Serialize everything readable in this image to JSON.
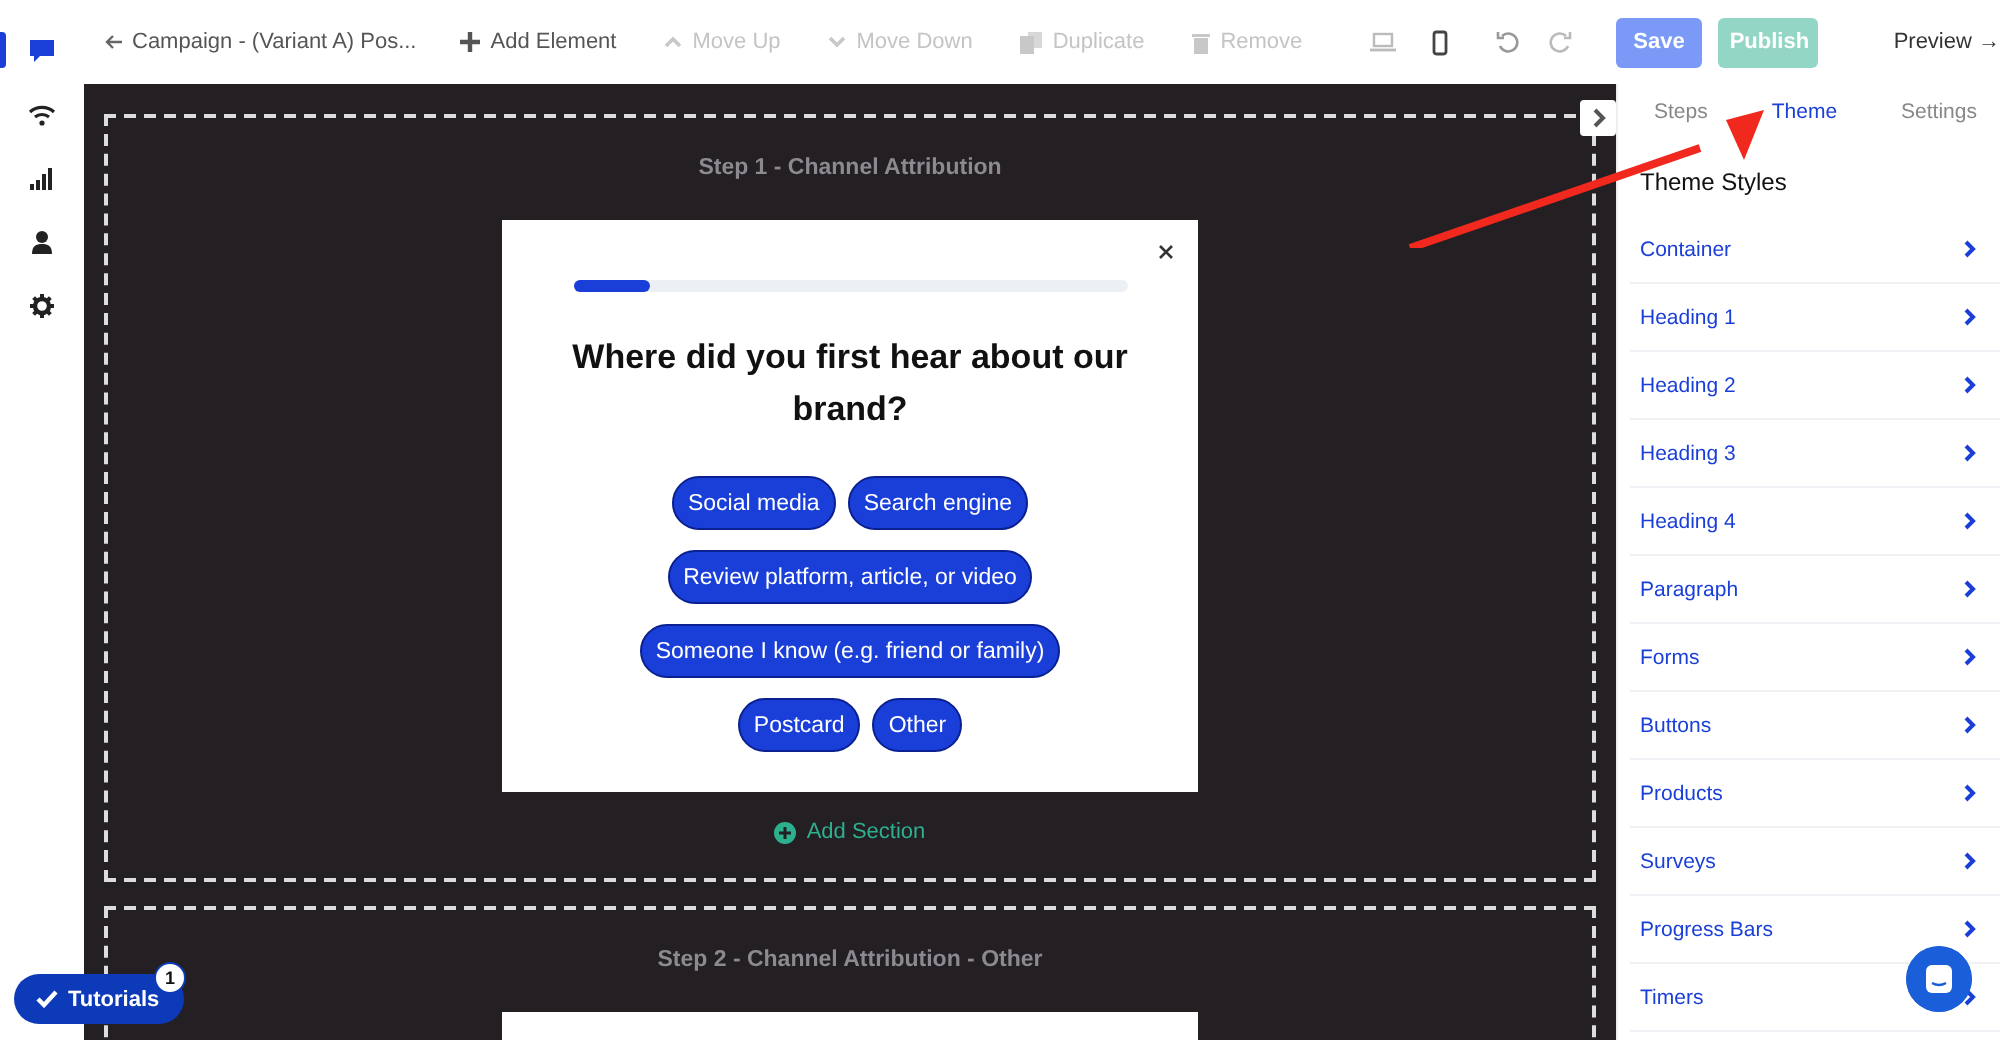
{
  "rail": [
    {
      "kind": "chat",
      "selected": true
    },
    {
      "kind": "wifi",
      "selected": false
    },
    {
      "kind": "bars",
      "selected": false
    },
    {
      "kind": "person",
      "selected": false
    },
    {
      "kind": "gear",
      "selected": false
    }
  ],
  "toolbar": {
    "back": "Campaign - (Variant A) Pos...",
    "actions": [
      {
        "kind": "plus",
        "label": "Add Element",
        "disabled": false
      },
      {
        "kind": "up",
        "label": "Move Up",
        "disabled": true
      },
      {
        "kind": "down",
        "label": "Move Down",
        "disabled": true
      },
      {
        "kind": "copy",
        "label": "Duplicate",
        "disabled": true
      },
      {
        "kind": "trash",
        "label": "Remove",
        "disabled": true
      }
    ],
    "devices": [
      {
        "kind": "desktop",
        "selected": false
      },
      {
        "kind": "mobile",
        "selected": true
      }
    ],
    "save": "Save",
    "publish": "Publish",
    "preview": "Preview →"
  },
  "steps": [
    {
      "title": "Step 1 - Channel Attribution",
      "card": {
        "level": 0.14,
        "question": "Where did you first hear about our brand?",
        "option_rows": [
          [
            "Social media",
            "Search engine"
          ],
          [
            "Review platform, article, or video"
          ],
          [
            "Someone I know (e.g. friend or family)"
          ],
          [
            "Postcard",
            "Other"
          ]
        ]
      },
      "add_section": "Add Section"
    },
    {
      "title": "Step 2 - Channel Attribution - Other"
    }
  ],
  "panel": {
    "tabs": [
      {
        "label": "Steps",
        "selected": false
      },
      {
        "label": "Theme",
        "selected": true
      },
      {
        "label": "Settings",
        "selected": false
      }
    ],
    "heading": "Theme Styles",
    "items": [
      "Container",
      "Heading 1",
      "Heading 2",
      "Heading 3",
      "Heading 4",
      "Paragraph",
      "Forms",
      "Buttons",
      "Products",
      "Surveys",
      "Progress Bars",
      "Timers"
    ]
  },
  "tutorials": {
    "label": "Tutorials",
    "badge": "1"
  }
}
